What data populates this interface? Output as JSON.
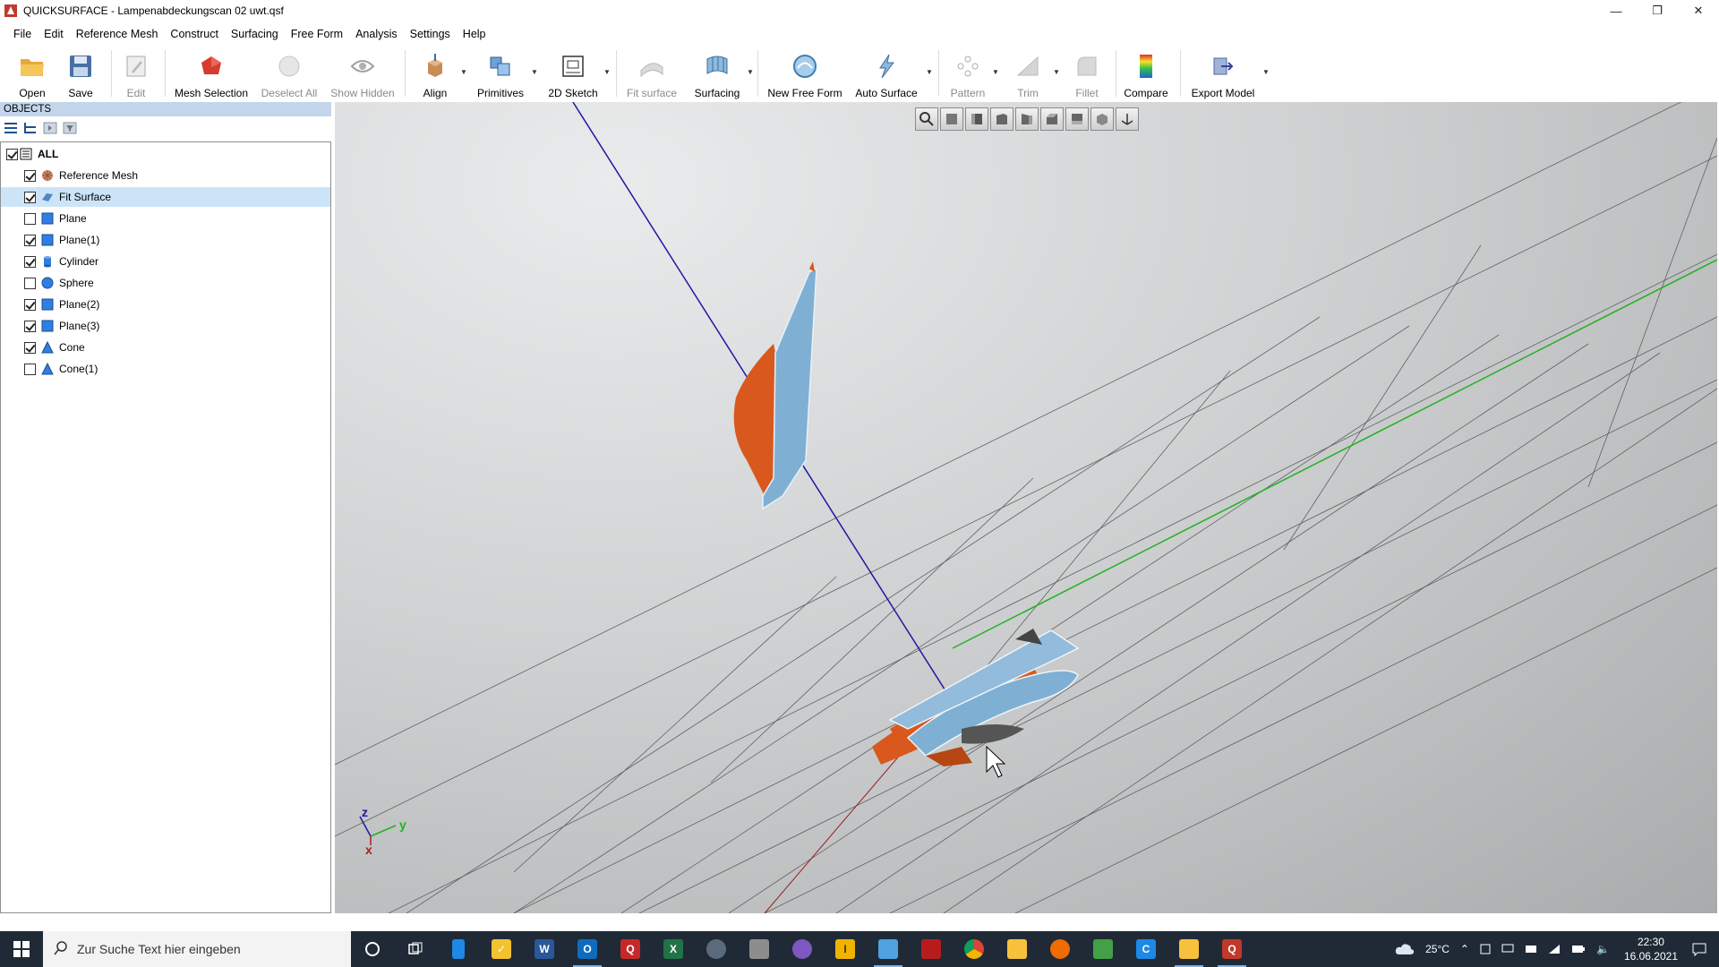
{
  "window": {
    "title": "QUICKSURFACE - Lampenabdeckungscan 02 uwt.qsf",
    "controls": [
      "minimize",
      "restore",
      "close"
    ]
  },
  "menu": [
    "File",
    "Edit",
    "Reference Mesh",
    "Construct",
    "Surfacing",
    "Free Form",
    "Analysis",
    "Settings",
    "Help"
  ],
  "toolbar": {
    "open": "Open",
    "save": "Save",
    "edit": "Edit",
    "mesh_selection": "Mesh Selection",
    "deselect_all": "Deselect All",
    "show_hidden": "Show Hidden",
    "align": "Align",
    "primitives": "Primitives",
    "sketch_2d": "2D Sketch",
    "fit_surface": "Fit surface",
    "surfacing": "Surfacing",
    "new_free_form": "New Free Form",
    "auto_surface": "Auto Surface",
    "pattern": "Pattern",
    "trim": "Trim",
    "fillet": "Fillet",
    "compare": "Compare",
    "export_model": "Export Model"
  },
  "objects_panel": {
    "header": "OBJECTS",
    "items": [
      {
        "label": "ALL",
        "checked": true,
        "icon": "list-icon"
      },
      {
        "label": "Reference Mesh",
        "checked": true,
        "icon": "mesh-icon"
      },
      {
        "label": "Fit Surface",
        "checked": true,
        "icon": "surface-icon",
        "selected": true
      },
      {
        "label": "Plane",
        "checked": false,
        "icon": "plane-icon"
      },
      {
        "label": "Plane(1)",
        "checked": true,
        "icon": "plane-icon"
      },
      {
        "label": "Cylinder",
        "checked": true,
        "icon": "cylinder-icon"
      },
      {
        "label": "Sphere",
        "checked": false,
        "icon": "sphere-icon"
      },
      {
        "label": "Plane(2)",
        "checked": true,
        "icon": "plane-icon"
      },
      {
        "label": "Plane(3)",
        "checked": true,
        "icon": "plane-icon"
      },
      {
        "label": "Cone",
        "checked": true,
        "icon": "cone-icon"
      },
      {
        "label": "Cone(1)",
        "checked": false,
        "icon": "cone-icon"
      }
    ]
  },
  "axes": {
    "z": "z",
    "y": "y",
    "x": "x"
  },
  "taskbar": {
    "search_placeholder": "Zur Suche Text hier eingeben",
    "temperature": "25°C",
    "time": "22:30",
    "date": "16.06.2021"
  },
  "colors": {
    "accent": "#c3d5ea",
    "selection": "#cce4f7",
    "mesh_orange": "#d9581e",
    "surface_blue": "#7aaed2",
    "taskbar": "#1f2a36"
  }
}
